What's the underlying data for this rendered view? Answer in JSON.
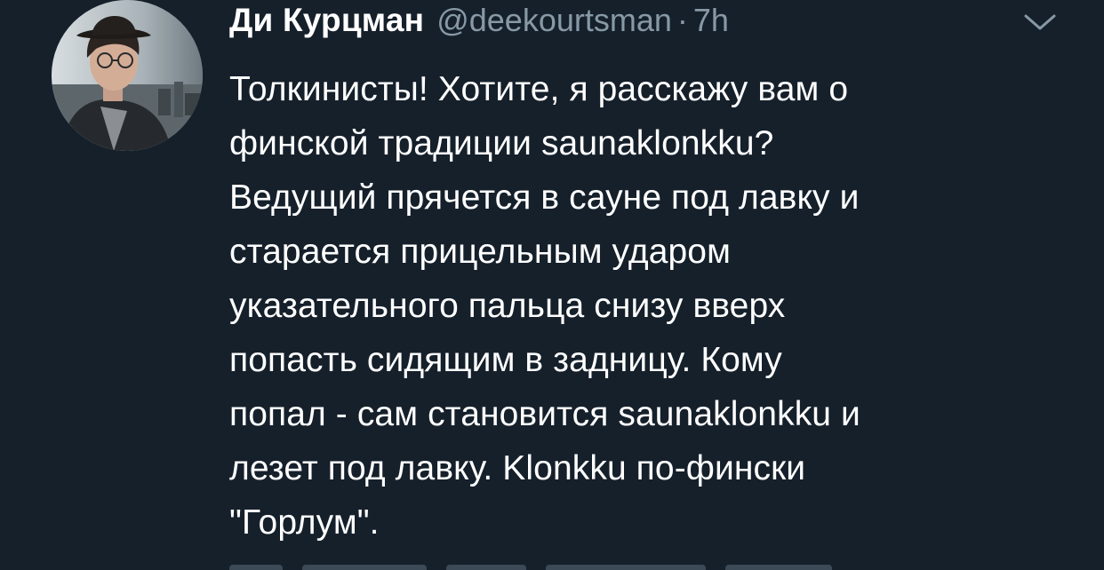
{
  "tweet": {
    "author_name": "Ди Курцман",
    "handle": "@deekourtsman",
    "separator": "·",
    "time": "7h",
    "lines": [
      "Толкинисты! Хотите, я расскажу вам о",
      "финской традиции saunaklonkku?",
      "Ведущий прячется в сауне под лавку и",
      "старается прицельным ударом",
      "указательного пальца снизу вверх",
      "попасть сидящим в задницу. Кому",
      "попал - сам становится saunaklonkku и",
      "лезет под лавку. Klonkku по-фински",
      "\"Горлум\"."
    ]
  },
  "icons": {
    "menu": "chevron-down-icon"
  },
  "colors": {
    "background": "#15202b",
    "text_primary": "#ffffff",
    "text_secondary": "#8899a6"
  }
}
